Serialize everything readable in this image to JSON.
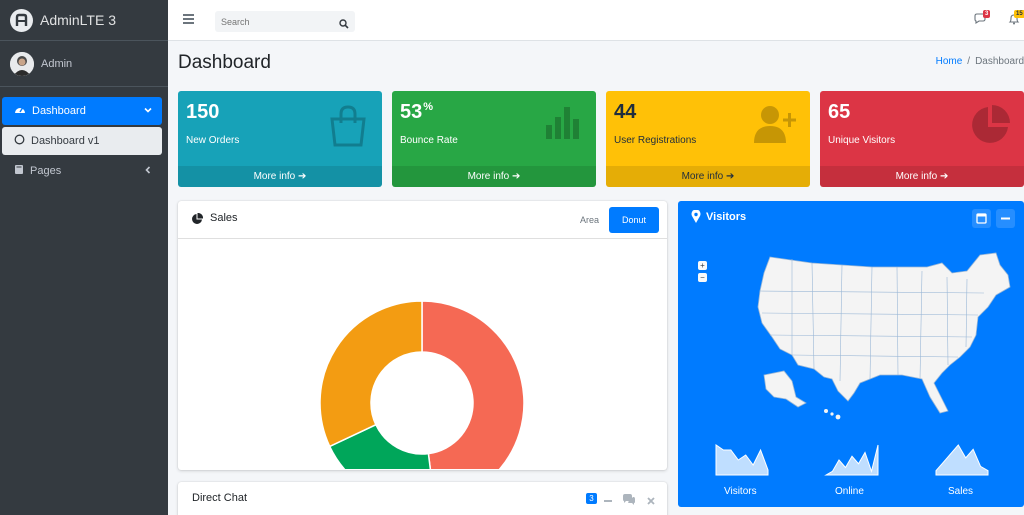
{
  "brand": {
    "name": "AdminLTE 3"
  },
  "user": {
    "name": "Admin"
  },
  "sidebar": {
    "items": [
      {
        "label": "Dashboard",
        "icon": "tachometer-icon"
      },
      {
        "label": "Dashboard v1",
        "icon": "circle-icon"
      },
      {
        "label": "Pages",
        "icon": "book-icon"
      }
    ]
  },
  "topbar": {
    "search_placeholder": "Search",
    "messages_count": "3",
    "notifications_count": "15"
  },
  "header": {
    "title": "Dashboard",
    "breadcrumb": [
      "Home",
      "/",
      "Dashboard"
    ]
  },
  "stats": [
    {
      "value": "150",
      "suffix": "",
      "label": "New Orders",
      "more": "More info",
      "color": "#17a2b8",
      "icon": "shopping-bag-icon"
    },
    {
      "value": "53",
      "suffix": "%",
      "label": "Bounce Rate",
      "more": "More info",
      "color": "#28a745",
      "icon": "bar-chart-icon"
    },
    {
      "value": "44",
      "suffix": "",
      "label": "User Registrations",
      "more": "More info",
      "color": "#ffc107",
      "icon": "user-plus-icon"
    },
    {
      "value": "65",
      "suffix": "",
      "label": "Unique Visitors",
      "more": "More info",
      "color": "#dc3545",
      "icon": "pie-chart-icon"
    }
  ],
  "sales": {
    "title": "Sales",
    "tabs": [
      "Area",
      "Donut"
    ],
    "active_tab": "Donut"
  },
  "chart_data": {
    "type": "pie",
    "variant": "donut",
    "values": [
      48,
      20,
      32
    ],
    "colors": [
      "#f56954",
      "#00a65a",
      "#f39c12"
    ]
  },
  "visitors": {
    "title": "Visitors",
    "zoom_in": "+",
    "zoom_out": "−",
    "sparklines": [
      {
        "label": "Visitors",
        "values": [
          6,
          5,
          5,
          3,
          4,
          2,
          5,
          1
        ]
      },
      {
        "label": "Online",
        "values": [
          0,
          1,
          4,
          2,
          5,
          3,
          6,
          1,
          8
        ]
      },
      {
        "label": "Sales",
        "values": [
          1,
          3,
          5,
          7,
          4,
          6,
          2,
          1
        ]
      }
    ]
  },
  "chat": {
    "title": "Direct Chat",
    "count": "3"
  }
}
